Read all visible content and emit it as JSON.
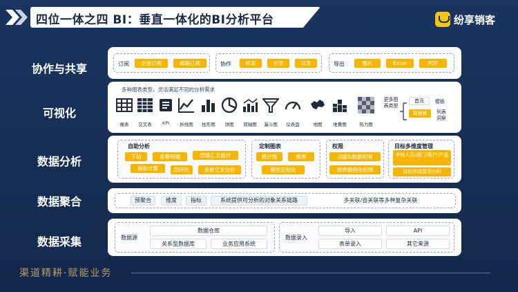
{
  "header": {
    "title": "四位一体之四 BI：垂直一体化的BI分析平台",
    "brand": "纷享销客"
  },
  "rows": {
    "collab": {
      "label": "协作与共享",
      "subscribe": {
        "label": "订阅",
        "items": [
          "企信订阅",
          "邮箱订阅"
        ]
      },
      "cooperate": {
        "label": "协作",
        "items": [
          "转发",
          "分享",
          "共享"
        ]
      },
      "export": {
        "label": "导出",
        "items": [
          "图片",
          "Excel",
          "PDF"
        ]
      }
    },
    "vis": {
      "label": "可视化",
      "note": "多种图表类型，灵活满足不同的分析需求",
      "icons": [
        {
          "name": "table-icon",
          "label": "报表"
        },
        {
          "name": "pivot-table-icon",
          "label": "交叉表"
        },
        {
          "name": "kpi-icon",
          "label": "KPI"
        },
        {
          "name": "line-chart-icon",
          "label": "折线图"
        },
        {
          "name": "bar-chart-icon",
          "label": "柱形图"
        },
        {
          "name": "pie-chart-icon",
          "label": "饼图"
        },
        {
          "name": "dual-axis-icon",
          "label": "双轴图"
        },
        {
          "name": "funnel-icon",
          "label": "漏斗图"
        },
        {
          "name": "gauge-icon",
          "label": "仪表盘"
        },
        {
          "name": "map-icon",
          "label": "地图"
        },
        {
          "name": "stacked-icon",
          "label": "堆叠图"
        },
        {
          "name": "heatmap-icon",
          "label": "热力图"
        }
      ],
      "more_label": "更多图表类型",
      "more_items": {
        "home": "首页",
        "template": "模板",
        "cockpit": "驾驶舱",
        "list_drill": "列表洞察"
      }
    },
    "analysis": {
      "label": "数据分析",
      "self_service": {
        "title": "自助分析",
        "items": [
          "下钻",
          "查看明细",
          "层级汇总统计",
          "指标计算",
          "同环比",
          "多维交叉分析"
        ]
      },
      "custom": {
        "title": "定制图表",
        "items": [
          "统计图",
          "报表",
          "模型定制化"
        ]
      },
      "permission": {
        "title": "权限",
        "items": [
          "功能&数据权限",
          "图表精细化权限"
        ]
      },
      "target": {
        "title": "目标多维度管理",
        "items": [
          "考核人员/部门/客户/产品",
          "目标完成情况分析"
        ]
      }
    },
    "aggregate": {
      "label": "数据聚合",
      "items": [
        "预聚合",
        "维度",
        "指标",
        "系统提供可分析的对象关系链路",
        "多关联/自关联等多种复杂关联"
      ]
    },
    "collect": {
      "label": "数据采集",
      "source": {
        "label": "数据源",
        "warehouse": "数据仓库",
        "relational": "关系型数据库",
        "business": "业务应用系统"
      },
      "entry": {
        "label": "数据录入",
        "import": "导入",
        "api": "API",
        "form": "表单录入",
        "other": "其它来源"
      }
    }
  },
  "footer": {
    "slogan": "渠道精耕·赋能业务"
  },
  "colors": {
    "accent": "#f7b500",
    "background": "#152a4e",
    "panel": "#ffffff"
  }
}
